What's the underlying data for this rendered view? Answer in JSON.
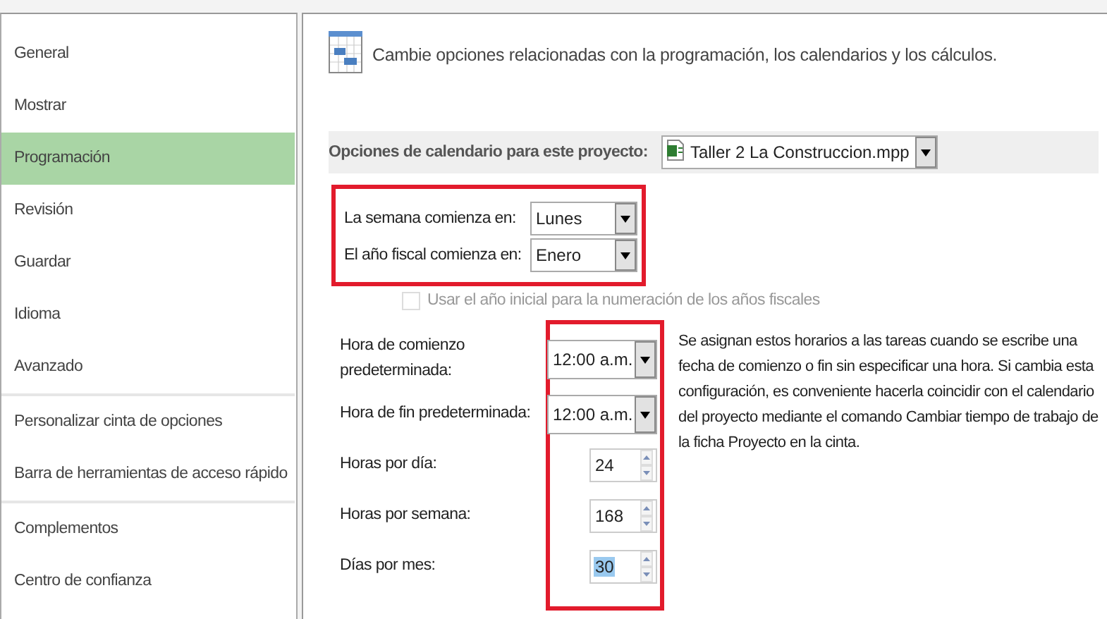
{
  "sidebar": {
    "items": [
      {
        "label": "General",
        "selected": false,
        "divider_after": false
      },
      {
        "label": "Mostrar",
        "selected": false,
        "divider_after": false
      },
      {
        "label": "Programación",
        "selected": true,
        "divider_after": false
      },
      {
        "label": "Revisión",
        "selected": false,
        "divider_after": false
      },
      {
        "label": "Guardar",
        "selected": false,
        "divider_after": false
      },
      {
        "label": "Idioma",
        "selected": false,
        "divider_after": false
      },
      {
        "label": "Avanzado",
        "selected": false,
        "divider_after": true
      },
      {
        "label": "Personalizar cinta de opciones",
        "selected": false,
        "divider_after": false
      },
      {
        "label": "Barra de herramientas de acceso rápido",
        "selected": false,
        "divider_after": true
      },
      {
        "label": "Complementos",
        "selected": false,
        "divider_after": false
      },
      {
        "label": "Centro de confianza",
        "selected": false,
        "divider_after": false
      }
    ]
  },
  "header": {
    "text": "Cambie opciones relacionadas con la programación, los calendarios y los cálculos."
  },
  "calendar_options": {
    "label": "Opciones de calendario para este proyecto:",
    "project": "Taller 2 La Construccion.mpp"
  },
  "week_settings": {
    "highlighted": true,
    "rows": [
      {
        "label": "La semana comienza en:",
        "value": "Lunes"
      },
      {
        "label": "El año fiscal comienza en:",
        "value": "Enero"
      }
    ]
  },
  "fiscal_checkbox": {
    "label": "Usar el año inicial para la numeración de los años fiscales",
    "checked": false,
    "disabled": true
  },
  "time_settings": {
    "highlighted": true,
    "rows": [
      {
        "label": "Hora de comienzo predeterminada:",
        "kind": "dropdown",
        "value": "12:00 a.m.",
        "text_selected": false
      },
      {
        "label": "Hora de fin predeterminada:",
        "kind": "dropdown",
        "value": "12:00 a.m.",
        "text_selected": false
      },
      {
        "label": "Horas por día:",
        "kind": "spinner",
        "value": "24",
        "text_selected": false
      },
      {
        "label": "Horas por semana:",
        "kind": "spinner",
        "value": "168",
        "text_selected": false
      },
      {
        "label": "Días por mes:",
        "kind": "spinner",
        "value": "30",
        "text_selected": true
      }
    ]
  },
  "description": "Se asignan estos horarios a las tareas cuando se escribe una fecha de comienzo o fin sin especificar una hora. Si cambia esta configuración, es conveniente hacerla coincidir con el calendario del proyecto mediante el comando Cambiar tiempo de trabajo de la ficha Proyecto en la cinta."
}
